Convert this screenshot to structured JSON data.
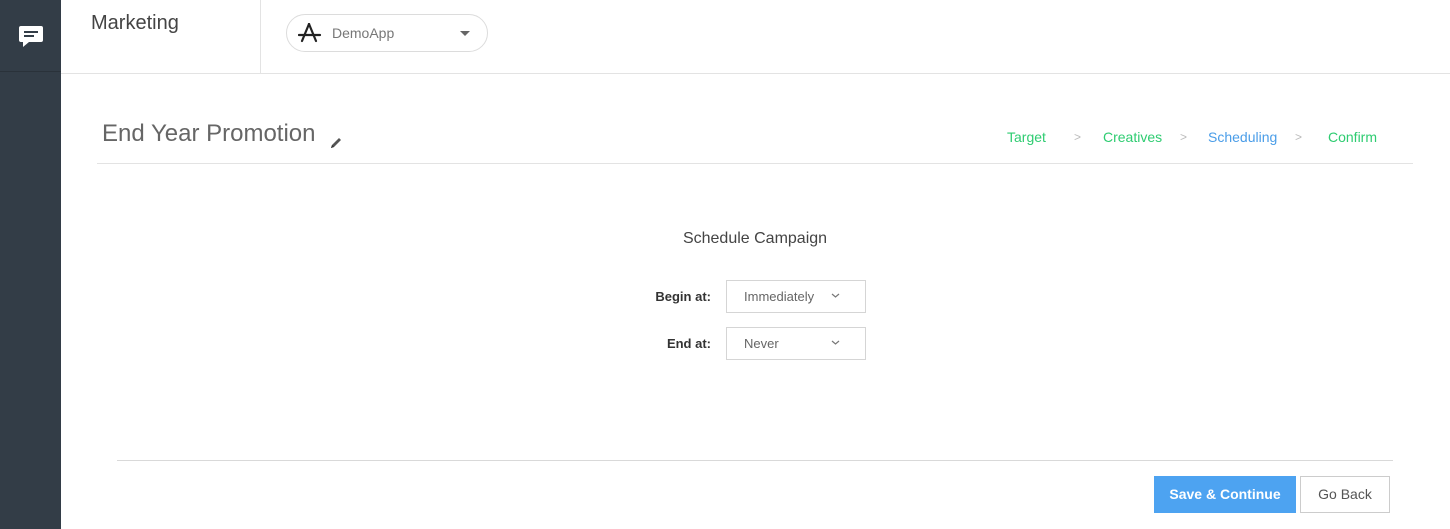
{
  "app": {
    "logo_icon": "chat-bubble-icon",
    "section_title": "Marketing",
    "app_selector": {
      "icon": "app-store-icon",
      "value": "DemoApp"
    }
  },
  "campaign": {
    "title": "End Year Promotion",
    "edit_icon": "pencil-icon"
  },
  "steps": [
    {
      "label": "Target",
      "state": "done"
    },
    {
      "label": "Creatives",
      "state": "done"
    },
    {
      "label": "Scheduling",
      "state": "active"
    },
    {
      "label": "Confirm",
      "state": "done"
    }
  ],
  "step_separator": ">",
  "schedule": {
    "heading": "Schedule Campaign",
    "begin": {
      "label": "Begin at:",
      "value": "Immediately"
    },
    "end": {
      "label": "End at:",
      "value": "Never"
    }
  },
  "actions": {
    "save_label": "Save & Continue",
    "back_label": "Go Back"
  },
  "colors": {
    "sidebar": "#333d47",
    "step_done": "#2ecc71",
    "step_active": "#4a9de8",
    "primary_button": "#4da3f1"
  }
}
